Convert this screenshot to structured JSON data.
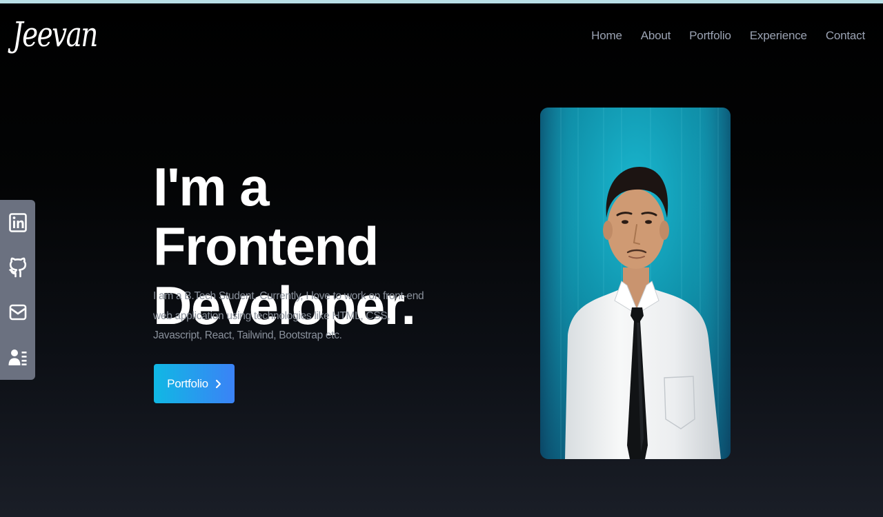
{
  "header": {
    "logo_text": "Jeevan",
    "nav": [
      {
        "label": "Home"
      },
      {
        "label": "About"
      },
      {
        "label": "Portfolio"
      },
      {
        "label": "Experience"
      },
      {
        "label": "Contact"
      }
    ]
  },
  "social": [
    {
      "icon": "linkedin-icon"
    },
    {
      "icon": "github-icon"
    },
    {
      "icon": "mail-icon"
    },
    {
      "icon": "resume-icon"
    }
  ],
  "hero": {
    "title_line1": "I'm a Frontend",
    "title_line2": "Developer.",
    "description": "I am a B.Tech Student. Currently, I love to work on front-end web application using technologies like HTML, CSS, Javascript, React, Tailwind, Bootstrap etc.",
    "button_label": "Portfolio",
    "button_icon": "chevron-right-icon"
  },
  "colors": {
    "top_strip": "#b9dfe6",
    "nav_text": "#9ba3b3",
    "social_bar": "#6b7180",
    "button_gradient_start": "#10b8e4",
    "button_gradient_end": "#3b82f6",
    "photo_background": "#0f8fa8"
  }
}
